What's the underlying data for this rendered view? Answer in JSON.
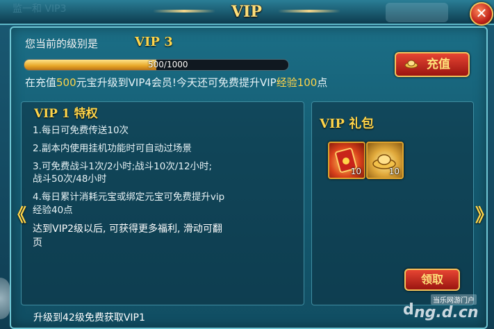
{
  "window": {
    "title": "VIP",
    "close_icon": "close-icon",
    "background_tab_text": "监一和 VIP3"
  },
  "header": {
    "level_label": "您当前的级别是",
    "level_value": "VIP 3"
  },
  "progress": {
    "current": 500,
    "max": 1000,
    "text": "500/1000",
    "fraction": 0.5
  },
  "charge_button": {
    "label": "充值",
    "icon": "gold-ingot-icon"
  },
  "notice": {
    "p1": "在充值",
    "amount": "500",
    "p2": "元宝升级到VIP4会员!今天还可免费提升VIP",
    "exp_word": "经验",
    "exp_points": "100",
    "p3": "点"
  },
  "perks": {
    "title": "VIP 1  特权",
    "items": [
      "1.每日可免费传送10次",
      "2.副本内使用挂机功能时可自动过场景",
      "3.可免费战斗1次/2小时;战斗10次/12小时;",
      "战斗50次/48小时",
      "4.每日累计消耗元宝或绑定元宝可免费提升vip",
      "经验40点",
      "达到VIP2级以后, 可获得更多福利, 滑动可翻",
      "页"
    ]
  },
  "gift": {
    "title": "VIP  礼包",
    "items": [
      {
        "icon": "red-envelope-icon",
        "qty": "10"
      },
      {
        "icon": "gold-ingot-icon",
        "qty": "10"
      }
    ],
    "claim_label": "领取"
  },
  "footer": {
    "text": "升级到42级免费获取VIP1"
  },
  "nav": {
    "left": "《",
    "right": "》"
  },
  "watermark": {
    "small": "当乐网游门户",
    "main": "ng.d.cn",
    "logo": "d"
  },
  "colors": {
    "accent_gold": "#ffd54a",
    "button_red": "#c2241b",
    "panel_teal": "#1b6e86"
  }
}
